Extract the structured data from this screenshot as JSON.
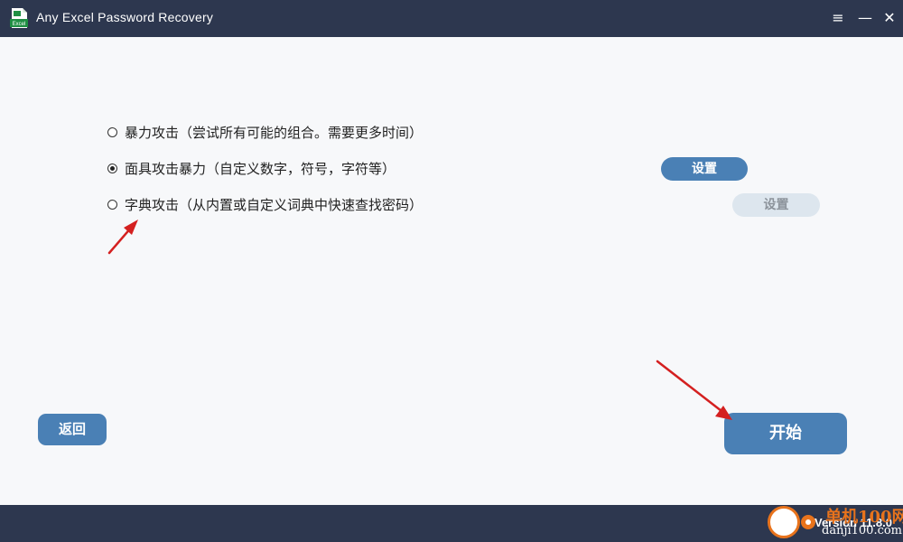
{
  "window": {
    "title": "Any Excel Password Recovery",
    "app_icon_label": "Excel",
    "controls": {
      "menu": "≡",
      "minimize": "—",
      "close": "✕"
    }
  },
  "options": [
    {
      "label": "暴力攻击（尝试所有可能的组合。需要更多时间）",
      "selected": false
    },
    {
      "label": "面具攻击暴力（自定义数字，符号，字符等）",
      "selected": true,
      "settings_label": "设置",
      "settings_enabled": true
    },
    {
      "label": "字典攻击（从内置或自定义词典中快速查找密码）",
      "selected": false,
      "settings_label": "设置",
      "settings_enabled": false
    }
  ],
  "buttons": {
    "back": "返回",
    "start": "开始"
  },
  "footer": {
    "version": "Version 11.8.0"
  },
  "watermark": {
    "top": "单机100网",
    "bottom": "danji100.com"
  },
  "colors": {
    "titlebar": "#2d374f",
    "accent": "#4a80b5",
    "arrow": "#d42020",
    "watermark": "#e8731c"
  }
}
